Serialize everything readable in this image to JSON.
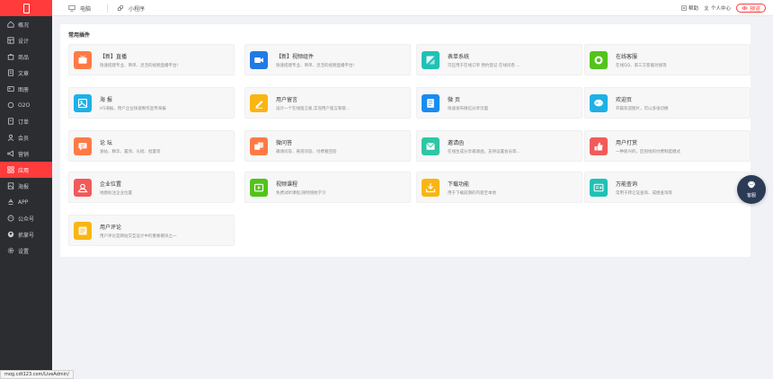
{
  "sidebar": {
    "items": [
      {
        "label": "概况",
        "icon": "house-icon"
      },
      {
        "label": "设计",
        "icon": "layout-icon"
      },
      {
        "label": "商品",
        "icon": "goods-icon"
      },
      {
        "label": "文章",
        "icon": "article-icon"
      },
      {
        "label": "图册",
        "icon": "album-icon"
      },
      {
        "label": "O2O",
        "icon": "o2o-icon"
      },
      {
        "label": "订单",
        "icon": "order-icon"
      },
      {
        "label": "会员",
        "icon": "member-icon"
      },
      {
        "label": "营销",
        "icon": "marketing-icon"
      },
      {
        "label": "应用",
        "icon": "apps-icon",
        "active": true
      },
      {
        "label": "海报",
        "icon": "poster-icon"
      },
      {
        "label": "APP",
        "icon": "app-icon"
      },
      {
        "label": "公众号",
        "icon": "wechat-icon"
      },
      {
        "label": "抓掌号",
        "icon": "account-icon"
      },
      {
        "label": "设置",
        "icon": "settings-icon"
      }
    ]
  },
  "topbar": {
    "tab_pc": "电脑",
    "tab_mini": "小程序",
    "help": "帮助",
    "user_center": "个人中心",
    "preview": "预览"
  },
  "main": {
    "section_title": "常用插件",
    "plugins": [
      {
        "name": "【新】直播",
        "desc": "快速搭建专业、简单、灵活的视频直播平台!",
        "color": "#ff7a45",
        "icon": "live-tv-icon"
      },
      {
        "name": "【新】视频组件",
        "desc": "快速搭建专业、简单、灵活的视频直播平台!",
        "color": "#1e7be6",
        "icon": "video-component-icon"
      },
      {
        "name": "表单系统",
        "desc": "可应用于在线订单 预约登记 在线问卷 …",
        "color": "#21c1b5",
        "icon": "form-icon"
      },
      {
        "name": "在线客服",
        "desc": "在线QQ、第三方客服对接等",
        "color": "#52c41a",
        "icon": "customer-service-icon"
      },
      {
        "name": "海 报",
        "desc": "H5海报，用户企业快速制作宣传海报",
        "color": "#1fb0e6",
        "icon": "poster-card-icon"
      },
      {
        "name": "用户留言",
        "desc": "设计一个在线留言板,实现用户留言和管…",
        "color": "#fab512",
        "icon": "message-icon"
      },
      {
        "name": "微 页",
        "desc": "快速发布微信分享页面",
        "color": "#1a8cf0",
        "icon": "micro-page-icon"
      },
      {
        "name": "欢迎页",
        "desc": "开篇欢迎图片，可以多张切换",
        "color": "#1fb0e6",
        "icon": "welcome-icon"
      },
      {
        "name": "论 坛",
        "desc": "发帖、精华、置顶、头街、批量等",
        "color": "#ff7a45",
        "icon": "forum-icon"
      },
      {
        "name": "微问答",
        "desc": "邀请问答、悬赏问答、付费看回答",
        "color": "#ff7a45",
        "icon": "qa-icon"
      },
      {
        "name": "邀请函",
        "desc": "在线生成分享邀请函，支持设置会员等…",
        "color": "#2ec6a4",
        "icon": "invitation-icon"
      },
      {
        "name": "用户打赏",
        "desc": "一种新兴的，区别地的付费制度模式",
        "color": "#f25a5a",
        "icon": "reward-icon"
      },
      {
        "name": "企业位置",
        "desc": "地图标注企业位置",
        "color": "#f25a5a",
        "icon": "location-icon"
      },
      {
        "name": "视频课程",
        "desc": "免费试听课程,随时随地学习",
        "color": "#52c41a",
        "icon": "video-course-icon"
      },
      {
        "name": "下载功能",
        "desc": "用于下载前期的内容至本地",
        "color": "#fab512",
        "icon": "download-icon"
      },
      {
        "name": "万能查询",
        "desc": "常用于转让证查询、成绩查询等",
        "color": "#21c1b5",
        "icon": "query-icon"
      },
      {
        "name": "用户评论",
        "desc": "用户评论是网站交互设计中的重要模块之一",
        "color": "#fab512",
        "icon": "comment-icon"
      }
    ]
  },
  "service": {
    "label": "客服"
  },
  "status": {
    "url": "mog.cdt123.com/LiveAdmin/"
  }
}
